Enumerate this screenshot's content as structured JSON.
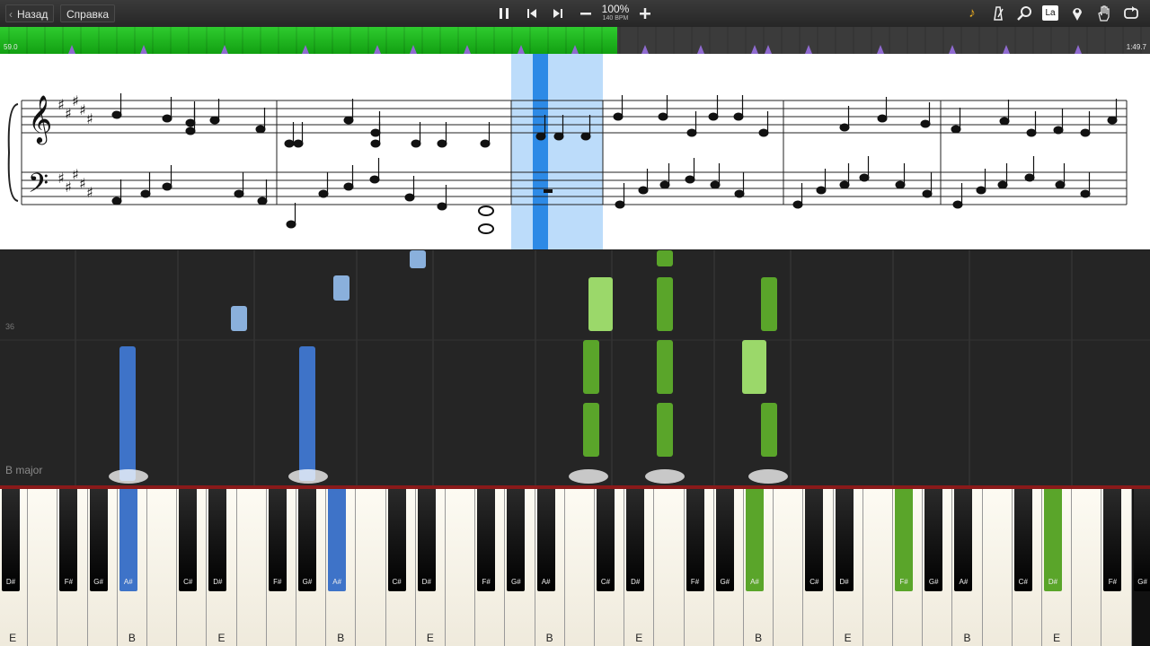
{
  "toolbar": {
    "back_label": "Назад",
    "help_label": "Справка",
    "speed_percent": "100%",
    "tempo": "140 BPM",
    "hand_label": "La"
  },
  "timeline": {
    "start_time": "59.0",
    "end_time": "1:49.7",
    "progress": 0.537
  },
  "piano_roll": {
    "key_signature": "B major",
    "measure_number": "36"
  },
  "keyboard": {
    "white_keys": [
      "E",
      "F",
      "G",
      "A",
      "B",
      "C",
      "D",
      "E",
      "F",
      "G",
      "A",
      "B",
      "C",
      "D",
      "E",
      "F",
      "G",
      "A",
      "B",
      "C",
      "D",
      "E",
      "F",
      "G",
      "A",
      "B",
      "C",
      "D",
      "E",
      "F",
      "G",
      "A",
      "B",
      "C",
      "D",
      "E",
      "F",
      "G"
    ],
    "visible_white_labels": [
      "E",
      "B",
      "E",
      "B",
      "E",
      "B",
      "E",
      "B",
      "E",
      "B",
      "E",
      "B",
      "E"
    ],
    "black_keys": [
      "C#",
      "D#",
      "F#",
      "G#",
      "A#",
      "C#",
      "D#",
      "F#",
      "G#",
      "A#",
      "C#",
      "D#",
      "F#",
      "G#",
      "A#",
      "C#",
      "D#",
      "F#",
      "G#",
      "A#",
      "C#",
      "D#",
      "F#",
      "G#",
      "A#",
      "C#",
      "D#",
      "F#",
      "G#",
      "A#",
      "C#",
      "D#",
      "F#",
      "G#",
      "A#",
      "C#",
      "D#"
    ]
  },
  "colors": {
    "left_hand": "#3e73c8",
    "right_hand": "#5aa52a",
    "progress": "#1fb51f",
    "current_measure": "#bcdcfa"
  }
}
